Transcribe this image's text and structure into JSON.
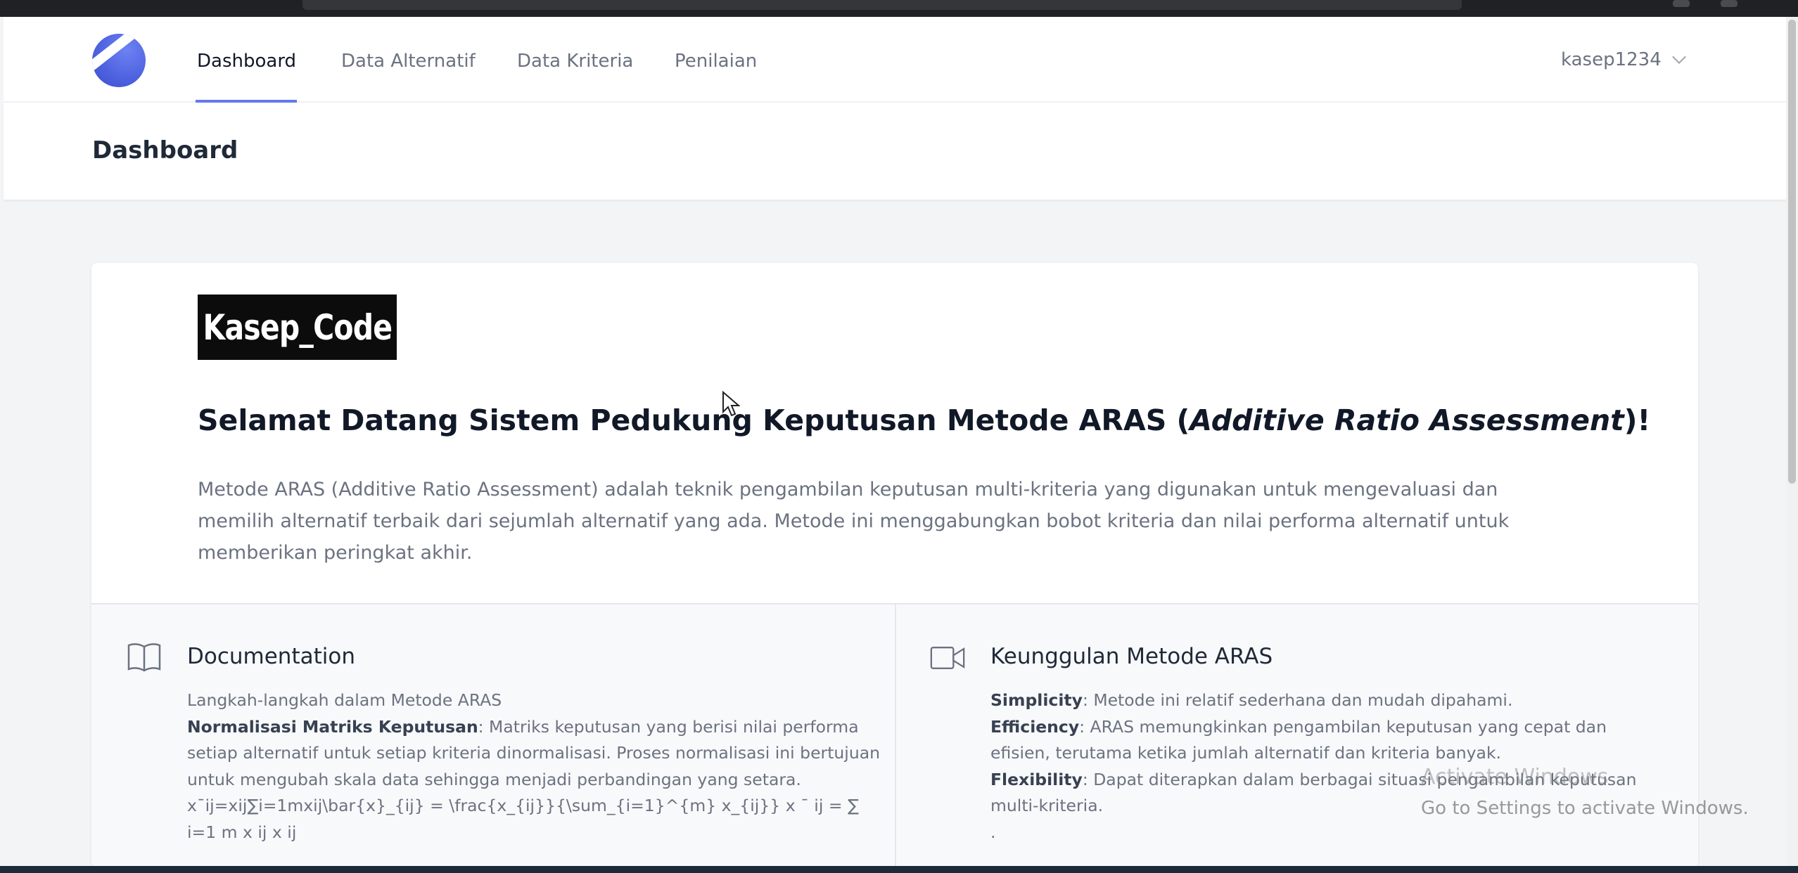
{
  "nav": {
    "items": [
      {
        "label": "Dashboard",
        "active": true
      },
      {
        "label": "Data Alternatif",
        "active": false
      },
      {
        "label": "Data Kriteria",
        "active": false
      },
      {
        "label": "Penilaian",
        "active": false
      }
    ],
    "user": "kasep1234"
  },
  "header": {
    "title": "Dashboard"
  },
  "card": {
    "brand": "Kasep_Code",
    "welcome_prefix": "Selamat Datang Sistem Pedukung Keputusan Metode ARAS (",
    "welcome_italic": "Additive Ratio Assessment",
    "welcome_suffix": ")!",
    "intro": "Metode ARAS (Additive Ratio Assessment) adalah teknik pengambilan keputusan multi-kriteria yang digunakan untuk mengevaluasi dan memilih alternatif terbaik dari sejumlah alternatif yang ada. Metode ini menggabungkan bobot kriteria dan nilai performa alternatif untuk memberikan peringkat akhir."
  },
  "documentation": {
    "title": "Documentation",
    "line1": "Langkah-langkah dalam Metode ARAS",
    "step_title": "Normalisasi Matriks Keputusan",
    "step_text": ": Matriks keputusan yang berisi nilai performa setiap alternatif untuk setiap kriteria dinormalisasi. Proses normalisasi ini bertujuan untuk mengubah skala data sehingga menjadi perbandingan yang setara.",
    "formula": "x¯ij=xij∑i=1mxij\\bar{x}_{ij} = \\frac{x_{ij}}{\\sum_{i=1}^{m} x_{ij}} x ˉ ij = ∑ i=1 m x ij x ij"
  },
  "advantages": {
    "title": "Keunggulan Metode ARAS",
    "items": [
      {
        "term": "Simplicity",
        "text": ": Metode ini relatif sederhana dan mudah dipahami."
      },
      {
        "term": "Efficiency",
        "text": ": ARAS memungkinkan pengambilan keputusan yang cepat dan efisien, terutama ketika jumlah alternatif dan kriteria banyak."
      },
      {
        "term": "Flexibility",
        "text": ": Dapat diterapkan dalam berbagai situasi pengambilan keputusan multi-kriteria."
      }
    ],
    "trailing": "."
  },
  "watermark": {
    "line1": "Activate Windows",
    "line2": "Go to Settings to activate Windows."
  }
}
